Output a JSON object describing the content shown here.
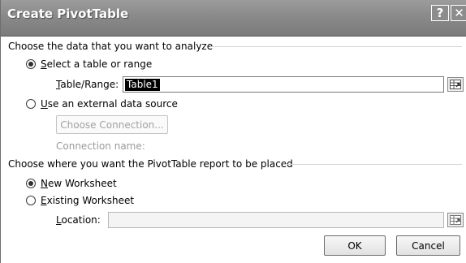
{
  "dialog": {
    "title": "Create PivotTable",
    "help_glyph": "?",
    "close_glyph": "✕"
  },
  "section_data": {
    "heading": "Choose the data that you want to analyze",
    "opt_table": {
      "pre": "",
      "ul": "S",
      "post": "elect a table or range",
      "checked": true
    },
    "table_range": {
      "ul": "T",
      "post": "able/Range:",
      "value": "Table1"
    },
    "opt_external": {
      "pre": "",
      "ul": "U",
      "post": "se an external data source",
      "checked": false
    },
    "choose_connection": "Choose Connection...",
    "connection_name_label": "Connection name:"
  },
  "section_place": {
    "heading": "Choose where you want the PivotTable report to be placed",
    "opt_new": {
      "ul": "N",
      "post": "ew Worksheet",
      "checked": true
    },
    "opt_existing": {
      "ul": "E",
      "post": "xisting Worksheet",
      "checked": false
    },
    "location": {
      "ul": "L",
      "post": "ocation:",
      "value": ""
    }
  },
  "buttons": {
    "ok": "OK",
    "cancel": "Cancel"
  },
  "icons": {
    "range_picker": "range-picker-icon"
  }
}
